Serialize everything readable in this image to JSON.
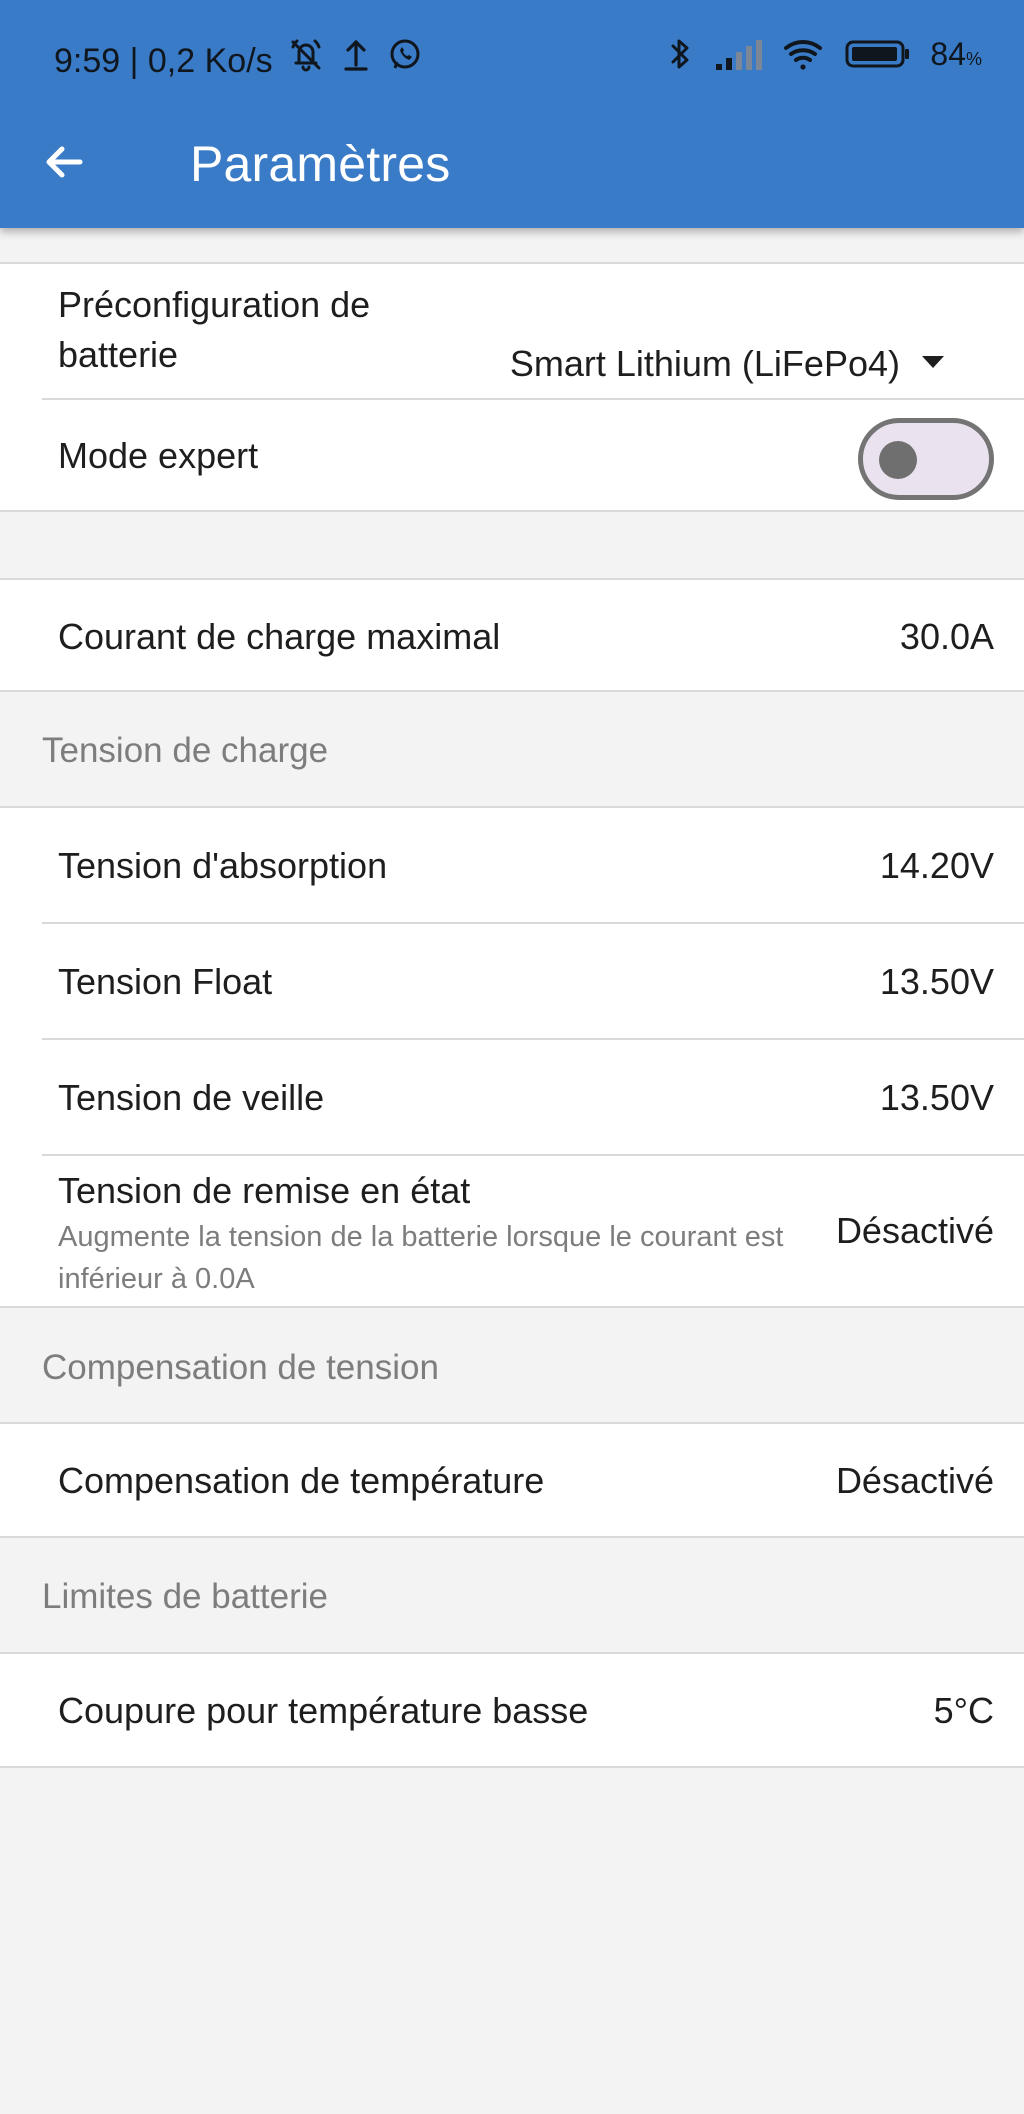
{
  "status_bar": {
    "left_text": "9:59 | 0,2 Ko/s",
    "battery_percent": "84",
    "battery_percent_suffix": "%",
    "icons": [
      "mute-notification-icon",
      "upload-icon",
      "whatsapp-icon",
      "bluetooth-icon",
      "signal-icon",
      "wifi-icon",
      "battery-icon"
    ]
  },
  "app_bar": {
    "title": "Paramètres",
    "back_icon": "arrow-left-icon",
    "background_color": "#3a7bc8"
  },
  "settings": {
    "battery_preset": {
      "label": "Préconfiguration de batterie",
      "value": "Smart Lithium (LiFePo4)",
      "icon": "dropdown-triangle-icon"
    },
    "expert_mode": {
      "label": "Mode expert",
      "enabled": false
    },
    "max_charge_current": {
      "label": "Courant de charge maximal",
      "value": "30.0A"
    },
    "charge_voltage_section": {
      "title": "Tension de charge",
      "items": [
        {
          "label": "Tension d'absorption",
          "value": "14.20V"
        },
        {
          "label": "Tension Float",
          "value": "13.50V"
        },
        {
          "label": "Tension de veille",
          "value": "13.50V"
        }
      ],
      "reconditioning": {
        "label": "Tension de remise en état",
        "description": "Augmente la tension de la batterie lorsque le courant est inférieur à 0.0A",
        "value": "Désactivé"
      }
    },
    "voltage_compensation_section": {
      "title": "Compensation de tension",
      "temperature_compensation": {
        "label": "Compensation de température",
        "value": "Désactivé"
      }
    },
    "battery_limits_section": {
      "title": "Limites de batterie",
      "low_temperature_cutoff": {
        "label": "Coupure pour température basse",
        "value": "5°C"
      }
    }
  }
}
